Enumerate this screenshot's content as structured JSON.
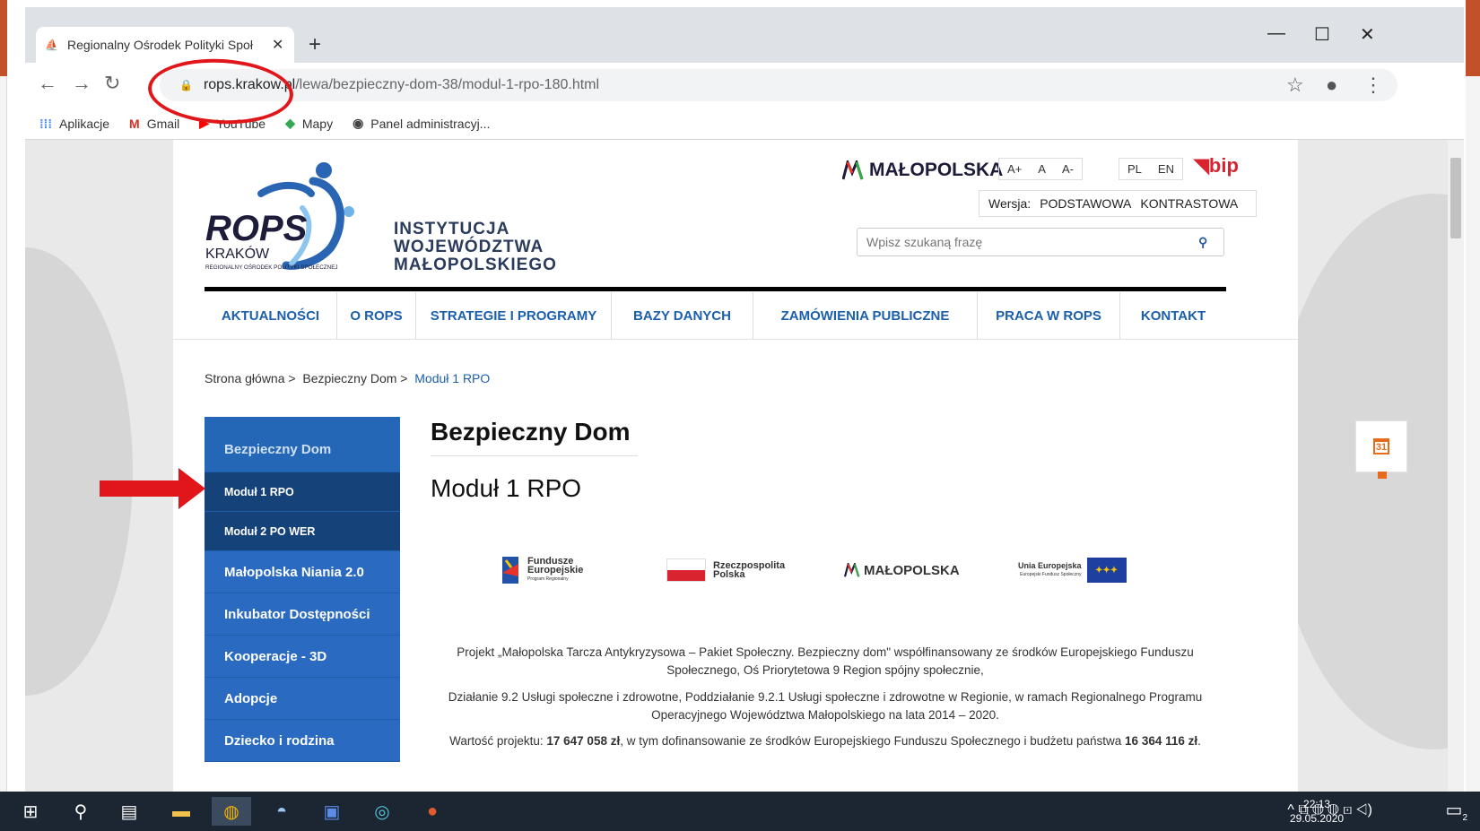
{
  "browser": {
    "tab_title": "Regionalny Ośrodek Polityki Społ",
    "new_tab": "+",
    "url_host": "rops.krakow.pl",
    "url_path": "/lewa/bezpieczny-dom-38/modul-1-rpo-180.html",
    "bookmarks": [
      {
        "icon": "apps-grid-icon",
        "label": "Aplikacje"
      },
      {
        "icon": "gmail-icon",
        "label": "Gmail"
      },
      {
        "icon": "youtube-icon",
        "label": "YouTube"
      },
      {
        "icon": "maps-icon",
        "label": "Mapy"
      },
      {
        "icon": "panel-icon",
        "label": "Panel administracyj..."
      }
    ]
  },
  "site": {
    "rops_word": "ROPS",
    "krakow": "KRAKÓW",
    "rops_full": "REGIONALNY OŚRODEK POLITYKI SPOŁECZNEJ",
    "inst_line1": "INSTYTUCJA",
    "inst_line2": "WOJEWÓDZTWA",
    "inst_line3": "MAŁOPOLSKIEGO",
    "malopolska": "MAŁOPOLSKA",
    "font_sizes": [
      "A+",
      "A",
      "A-"
    ],
    "langs": [
      "PL",
      "EN"
    ],
    "bip": "bip",
    "version_label": "Wersja:",
    "version_basic": "PODSTAWOWA",
    "version_contrast": "KONTRASTOWA",
    "search_placeholder": "Wpisz szukaną frazę",
    "menu": [
      "AKTUALNOŚCI",
      "O ROPS",
      "STRATEGIE I PROGRAMY",
      "BAZY DANYCH",
      "ZAMÓWIENIA PUBLICZNE",
      "PRACA W ROPS",
      "KONTAKT"
    ],
    "breadcrumb": [
      "Strona główna >",
      "Bezpieczny Dom >",
      "Moduł 1 RPO"
    ],
    "sidebar": {
      "top": "Bezpieczny Dom",
      "sub": [
        "Moduł 1 RPO",
        "Moduł 2 PO WER"
      ],
      "main": [
        "Małopolska Niania 2.0",
        "Inkubator Dostępności",
        "Kooperacje - 3D",
        "Adopcje",
        "Dziecko i rodzina"
      ]
    },
    "heading1": "Bezpieczny Dom",
    "heading2": "Moduł 1 RPO",
    "logos": {
      "fe_line1": "Fundusze",
      "fe_line2": "Europejskie",
      "fe_line3": "Program Regionalny",
      "rp_line1": "Rzeczpospolita",
      "rp_line2": "Polska",
      "mp": "MAŁOPOLSKA",
      "ue_line1": "Unia Europejska",
      "ue_line2": "Europejski Fundusz Społeczny"
    },
    "para1": "Projekt „Małopolska Tarcza Antykryzysowa – Pakiet Społeczny. Bezpieczny dom\" współfinansowany ze środków Europejskiego Funduszu Społecznego, Oś Priorytetowa 9 Region spójny społecznie,",
    "para2": "Działanie 9.2 Usługi społeczne i zdrowotne, Poddziałanie 9.2.1 Usługi społeczne i zdrowotne w Regionie, w ramach Regionalnego Programu Operacyjnego Województwa Małopolskiego na lata 2014 – 2020.",
    "para3_a": "Wartość projektu: ",
    "para3_b": "17 647 058 zł",
    "para3_c": ", w tym dofinansowanie ze środków Europejskiego Funduszu Społecznego i budżetu państwa ",
    "para3_d": "16 364 116 zł",
    "para3_e": ".",
    "calendar_day": "31"
  },
  "taskbar": {
    "time": "22:13",
    "date": "29.05.2020",
    "notif_count": "2"
  },
  "colors": {
    "accent_blue": "#1b5fad",
    "annotation_red": "#e0161a"
  }
}
